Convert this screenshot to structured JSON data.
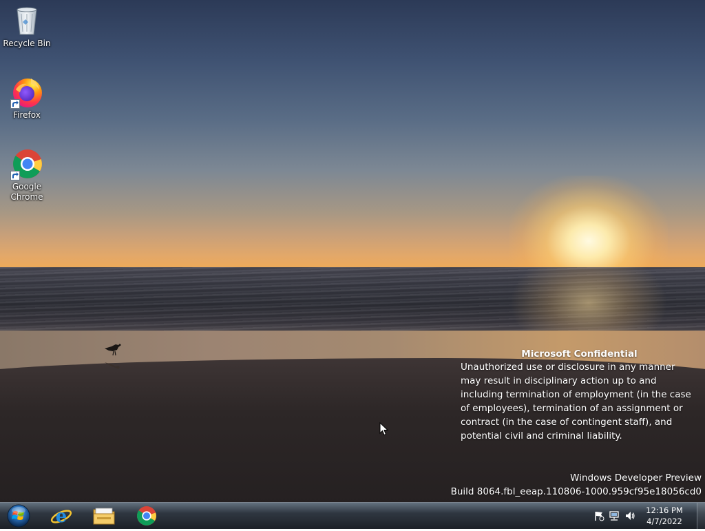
{
  "desktop": {
    "icons": [
      {
        "label": "Recycle Bin",
        "icon": "recycle-bin-icon"
      },
      {
        "label": "Firefox",
        "icon": "firefox-icon"
      },
      {
        "label": "Google Chrome",
        "icon": "chrome-icon"
      }
    ],
    "watermark": {
      "title": "Microsoft Confidential",
      "body": "Unauthorized use or disclosure in any manner may result in disciplinary action up to and including termination of employment (in the case of employees), termination of an assignment or contract (in the case of contingent staff), and potential civil and criminal liability."
    },
    "build": {
      "line1": "Windows Developer Preview",
      "line2": "Build 8064.fbl_eeap.110806-1000.959cf95e18056cd0"
    }
  },
  "taskbar": {
    "start_icon": "windows-start-orb-icon",
    "pinned": [
      {
        "name": "Internet Explorer",
        "icon": "internet-explorer-icon"
      },
      {
        "name": "Windows Explorer",
        "icon": "file-explorer-icon"
      },
      {
        "name": "Google Chrome",
        "icon": "chrome-icon"
      }
    ],
    "tray": {
      "icons": [
        "action-center-flag-icon",
        "network-icon",
        "volume-icon"
      ],
      "time": "12:16 PM",
      "date": "4/7/2022"
    }
  },
  "colors": {
    "taskbar": "#1c2128",
    "text": "#ffffff",
    "sky_top": "#2c3a57",
    "horizon": "#f0a649"
  }
}
